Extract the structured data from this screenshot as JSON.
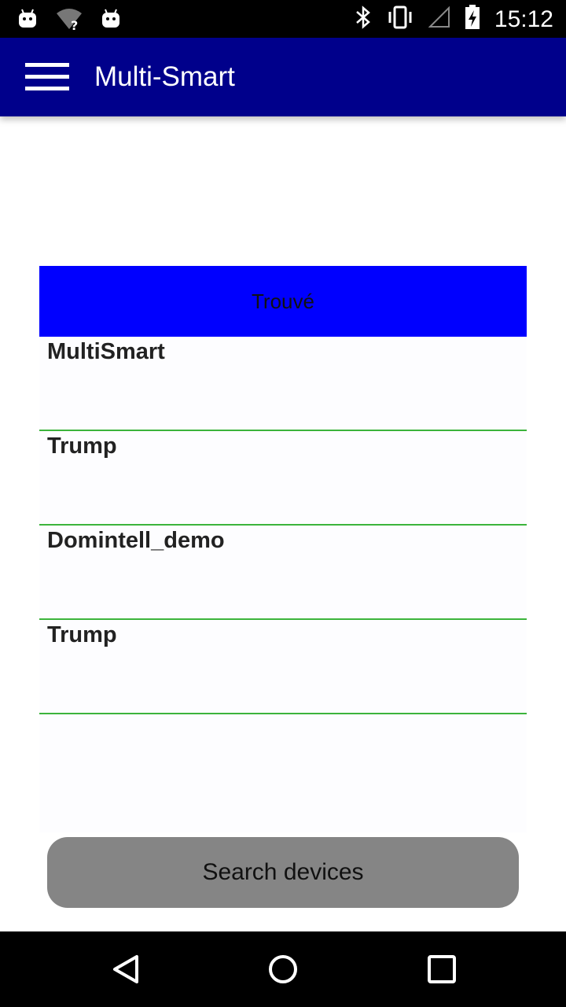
{
  "status_bar": {
    "time": "15:12",
    "icons_left": [
      "android-icon",
      "wifi-unknown-icon",
      "android-icon"
    ],
    "icons_right": [
      "bluetooth-icon",
      "vibrate-icon",
      "signal-icon",
      "battery-charging-icon"
    ]
  },
  "app_bar": {
    "title": "Multi-Smart",
    "color": "#00008b"
  },
  "list": {
    "header": "Trouvé",
    "header_color": "#0000ff",
    "divider_color": "#3cb43c",
    "items": [
      {
        "name": "MultiSmart"
      },
      {
        "name": "Trump"
      },
      {
        "name": "Domintell_demo"
      },
      {
        "name": "Trump"
      }
    ]
  },
  "search_button": {
    "label": "Search devices",
    "color": "#858585"
  },
  "nav_bar": {
    "buttons": [
      "back-icon",
      "home-icon",
      "recents-icon"
    ]
  }
}
